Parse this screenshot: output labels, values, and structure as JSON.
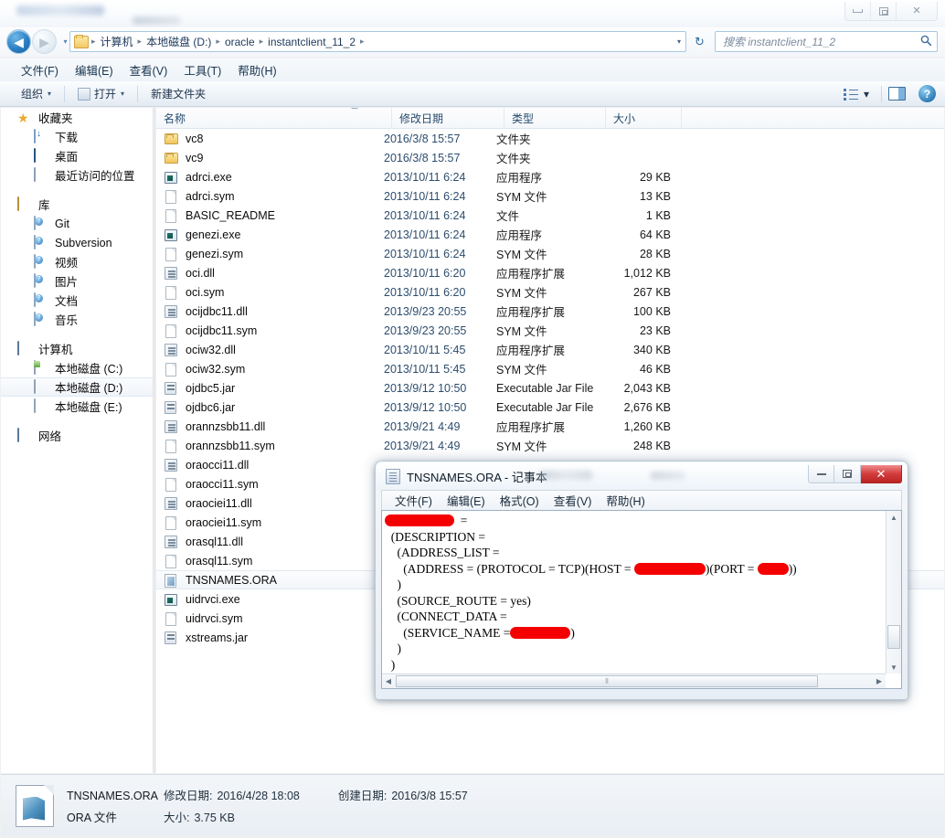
{
  "explorer": {
    "window_controls": {
      "minimize": "—",
      "maximize": "□",
      "close": "✕"
    },
    "nav": {
      "back_label": "◀",
      "forward_label": "▶",
      "dropdown_label": "▾",
      "refresh_label": "↻"
    },
    "breadcrumb": {
      "items": [
        "计算机",
        "本地磁盘 (D:)",
        "oracle",
        "instantclient_11_2"
      ],
      "separator": "▸",
      "caret": "▾"
    },
    "search": {
      "placeholder": "搜索 instantclient_11_2",
      "icon": "search-icon"
    },
    "menus": [
      "文件(F)",
      "编辑(E)",
      "查看(V)",
      "工具(T)",
      "帮助(H)"
    ],
    "toolbar": {
      "organize": "组织",
      "open": "打开",
      "new_folder": "新建文件夹",
      "caret": "▾",
      "view_icon": "list-view-icon",
      "view_caret": "▾",
      "preview_pane_icon": "preview-pane-icon",
      "help_icon": "?"
    },
    "sidebar": {
      "groups": [
        {
          "header": {
            "label": "收藏夹",
            "icon": "star-icon"
          },
          "items": [
            {
              "label": "下载",
              "icon": "download-icon"
            },
            {
              "label": "桌面",
              "icon": "desktop-icon"
            },
            {
              "label": "最近访问的位置",
              "icon": "recent-places-icon"
            }
          ]
        },
        {
          "header": {
            "label": "库",
            "icon": "library-icon"
          },
          "items": [
            {
              "label": "Git",
              "icon": "library-item-icon"
            },
            {
              "label": "Subversion",
              "icon": "library-item-icon"
            },
            {
              "label": "视频",
              "icon": "library-item-icon"
            },
            {
              "label": "图片",
              "icon": "library-item-icon"
            },
            {
              "label": "文档",
              "icon": "library-item-icon"
            },
            {
              "label": "音乐",
              "icon": "library-item-icon"
            }
          ]
        },
        {
          "header": {
            "label": "计算机",
            "icon": "computer-icon"
          },
          "items": [
            {
              "label": "本地磁盘 (C:)",
              "icon": "system-drive-icon",
              "selected": false
            },
            {
              "label": "本地磁盘 (D:)",
              "icon": "drive-icon",
              "selected": true
            },
            {
              "label": "本地磁盘 (E:)",
              "icon": "drive-icon",
              "selected": false
            }
          ]
        },
        {
          "header": {
            "label": "网络",
            "icon": "network-icon"
          },
          "items": []
        }
      ]
    },
    "filelist": {
      "columns": [
        "名称",
        "修改日期",
        "类型",
        "大小"
      ],
      "sort_column": "名称",
      "sort_direction": "asc",
      "rows": [
        {
          "name": "vc8",
          "icon": "folder-icon",
          "date": "2016/3/8 15:57",
          "type": "文件夹",
          "size": ""
        },
        {
          "name": "vc9",
          "icon": "folder-icon",
          "date": "2016/3/8 15:57",
          "type": "文件夹",
          "size": ""
        },
        {
          "name": "adrci.exe",
          "icon": "exe-icon",
          "date": "2013/10/11 6:24",
          "type": "应用程序",
          "size": "29 KB"
        },
        {
          "name": "adrci.sym",
          "icon": "file-icon",
          "date": "2013/10/11 6:24",
          "type": "SYM 文件",
          "size": "13 KB"
        },
        {
          "name": "BASIC_README",
          "icon": "file-icon",
          "date": "2013/10/11 6:24",
          "type": "文件",
          "size": "1 KB"
        },
        {
          "name": "genezi.exe",
          "icon": "exe-icon",
          "date": "2013/10/11 6:24",
          "type": "应用程序",
          "size": "64 KB"
        },
        {
          "name": "genezi.sym",
          "icon": "file-icon",
          "date": "2013/10/11 6:24",
          "type": "SYM 文件",
          "size": "28 KB"
        },
        {
          "name": "oci.dll",
          "icon": "dll-icon",
          "date": "2013/10/11 6:20",
          "type": "应用程序扩展",
          "size": "1,012 KB"
        },
        {
          "name": "oci.sym",
          "icon": "file-icon",
          "date": "2013/10/11 6:20",
          "type": "SYM 文件",
          "size": "267 KB"
        },
        {
          "name": "ocijdbc11.dll",
          "icon": "dll-icon",
          "date": "2013/9/23 20:55",
          "type": "应用程序扩展",
          "size": "100 KB"
        },
        {
          "name": "ocijdbc11.sym",
          "icon": "file-icon",
          "date": "2013/9/23 20:55",
          "type": "SYM 文件",
          "size": "23 KB"
        },
        {
          "name": "ociw32.dll",
          "icon": "dll-icon",
          "date": "2013/10/11 5:45",
          "type": "应用程序扩展",
          "size": "340 KB"
        },
        {
          "name": "ociw32.sym",
          "icon": "file-icon",
          "date": "2013/10/11 5:45",
          "type": "SYM 文件",
          "size": "46 KB"
        },
        {
          "name": "ojdbc5.jar",
          "icon": "jar-icon",
          "date": "2013/9/12 10:50",
          "type": "Executable Jar File",
          "size": "2,043 KB"
        },
        {
          "name": "ojdbc6.jar",
          "icon": "jar-icon",
          "date": "2013/9/12 10:50",
          "type": "Executable Jar File",
          "size": "2,676 KB"
        },
        {
          "name": "orannzsbb11.dll",
          "icon": "dll-icon",
          "date": "2013/9/21 4:49",
          "type": "应用程序扩展",
          "size": "1,260 KB"
        },
        {
          "name": "orannzsbb11.sym",
          "icon": "file-icon",
          "date": "2013/9/21 4:49",
          "type": "SYM 文件",
          "size": "248 KB"
        },
        {
          "name": "oraocci11.dll",
          "icon": "dll-icon",
          "date": "",
          "type": "",
          "size": ""
        },
        {
          "name": "oraocci11.sym",
          "icon": "file-icon",
          "date": "",
          "type": "",
          "size": ""
        },
        {
          "name": "oraociei11.dll",
          "icon": "dll-icon",
          "date": "",
          "type": "",
          "size": ""
        },
        {
          "name": "oraociei11.sym",
          "icon": "file-icon",
          "date": "",
          "type": "",
          "size": ""
        },
        {
          "name": "orasql11.dll",
          "icon": "dll-icon",
          "date": "",
          "type": "",
          "size": ""
        },
        {
          "name": "orasql11.sym",
          "icon": "file-icon",
          "date": "",
          "type": "",
          "size": ""
        },
        {
          "name": "TNSNAMES.ORA",
          "icon": "ora-icon",
          "date": "",
          "type": "",
          "size": "",
          "selected": true
        },
        {
          "name": "uidrvci.exe",
          "icon": "exe-icon",
          "date": "",
          "type": "",
          "size": ""
        },
        {
          "name": "uidrvci.sym",
          "icon": "file-icon",
          "date": "",
          "type": "",
          "size": ""
        },
        {
          "name": "xstreams.jar",
          "icon": "jar-icon",
          "date": "",
          "type": "",
          "size": ""
        }
      ]
    },
    "details": {
      "filename": "TNSNAMES.ORA",
      "modified_label": "修改日期:",
      "modified_value": "2016/4/28 18:08",
      "created_label": "创建日期:",
      "created_value": "2016/3/8 15:57",
      "filetype": "ORA 文件",
      "size_label": "大小:",
      "size_value": "3.75 KB",
      "icon": "ora-file-large-icon"
    }
  },
  "notepad": {
    "title": "TNSNAMES.ORA - 记事本",
    "icon": "notepad-icon",
    "window_controls": {
      "minimize": "—",
      "maximize": "□",
      "close": "✕"
    },
    "menus": [
      "文件(F)",
      "编辑(E)",
      "格式(O)",
      "查看(V)",
      "帮助(H)"
    ],
    "content_lines": [
      {
        "segments": [
          {
            "redact": 76
          },
          {
            "text": "  ="
          }
        ]
      },
      {
        "segments": [
          {
            "text": "  (DESCRIPTION ="
          }
        ]
      },
      {
        "segments": [
          {
            "text": "    (ADDRESS_LIST ="
          }
        ]
      },
      {
        "segments": [
          {
            "text": "      (ADDRESS = (PROTOCOL = TCP)(HOST = "
          },
          {
            "redact": 78
          },
          {
            "text": ")(PORT = "
          },
          {
            "redact": 34
          },
          {
            "text": "))"
          }
        ]
      },
      {
        "segments": [
          {
            "text": "    )"
          }
        ]
      },
      {
        "segments": [
          {
            "text": "    (SOURCE_ROUTE = yes)"
          }
        ]
      },
      {
        "segments": [
          {
            "text": "    (CONNECT_DATA ="
          }
        ]
      },
      {
        "segments": [
          {
            "text": "      (SERVICE_NAME ="
          },
          {
            "redact": 66
          },
          {
            "text": ")"
          }
        ]
      },
      {
        "segments": [
          {
            "text": "    )"
          }
        ]
      },
      {
        "segments": [
          {
            "text": "  )"
          }
        ]
      }
    ],
    "scrollbars": {
      "v_up": "▲",
      "v_down": "▼",
      "h_left": "◀",
      "h_right": "▶",
      "grip": "⦀"
    }
  }
}
